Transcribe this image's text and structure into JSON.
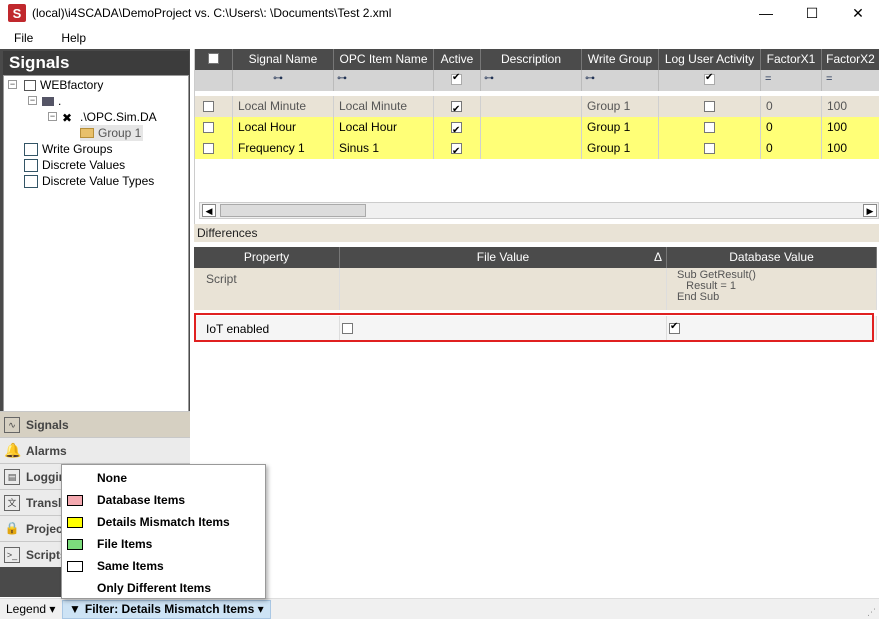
{
  "window": {
    "title": "(local)\\i4SCADA\\DemoProject vs. C:\\Users\\:   \\Documents\\Test 2.xml",
    "minimize": "—",
    "maximize": "☐",
    "close": "✕"
  },
  "menu": [
    "File",
    "Help"
  ],
  "left_panel": {
    "header": "Signals",
    "tree": {
      "root": "WEBfactory",
      "server": ".",
      "opc": ".\\OPC.Sim.DA",
      "group": "Group 1",
      "write_groups": "Write Groups",
      "discrete_values": "Discrete Values",
      "discrete_value_types": "Discrete Value Types"
    },
    "splitter": "••••••••••",
    "nav": [
      "Signals",
      "Alarms",
      "Logging",
      "Translations",
      "Projects",
      "Scripts"
    ]
  },
  "grid": {
    "columns": [
      "",
      "Signal Name",
      "OPC Item Name",
      "Active",
      "Description",
      "Write Group",
      "Log User Activity",
      "FactorX1",
      "FactorX2"
    ],
    "rows": [
      {
        "signal": "Local Minute",
        "opc": "Local Minute",
        "active": true,
        "description": "",
        "write_group": "Group 1",
        "log_user": false,
        "fx1": "0",
        "fx2": "100",
        "color": "#e9e3d6",
        "text_color": "#555555"
      },
      {
        "signal": "Local Hour",
        "opc": "Local Hour",
        "active": true,
        "description": "",
        "write_group": "Group 1",
        "log_user": false,
        "fx1": "0",
        "fx2": "100",
        "color": "#ffff77",
        "text_color": "#000000"
      },
      {
        "signal": "Frequency 1",
        "opc": "Sinus 1",
        "active": true,
        "description": "",
        "write_group": "Group 1",
        "log_user": false,
        "fx1": "0",
        "fx2": "100",
        "color": "#ffff77",
        "text_color": "#000000"
      }
    ]
  },
  "differences": {
    "label": "Differences",
    "columns": [
      "Property",
      "File Value",
      "Database Value"
    ],
    "sort_glyph": "Δ",
    "rows": [
      {
        "property": "Script",
        "file_value": "",
        "database_value": "Sub GetResult()\n   Result = 1\nEnd Sub"
      },
      {
        "property": "IoT enabled",
        "file_checked": false,
        "database_checked": true
      }
    ]
  },
  "status": {
    "legend": "Legend ▾",
    "filter": "Filter: Details Mismatch Items ▾"
  },
  "popup": {
    "items": [
      {
        "label": "None",
        "swatch": ""
      },
      {
        "label": "Database Items",
        "swatch": "#f4a9b0"
      },
      {
        "label": "Details Mismatch Items",
        "swatch": "#ffff00"
      },
      {
        "label": "File Items",
        "swatch": "#7cdc7c"
      },
      {
        "label": "Same Items",
        "swatch": "#ffffff"
      },
      {
        "label": "Only Different Items",
        "swatch": ""
      }
    ]
  },
  "colors": {
    "accent_red": "#e02020",
    "header": "#4b4b4b",
    "mismatch": "#ffff77"
  }
}
